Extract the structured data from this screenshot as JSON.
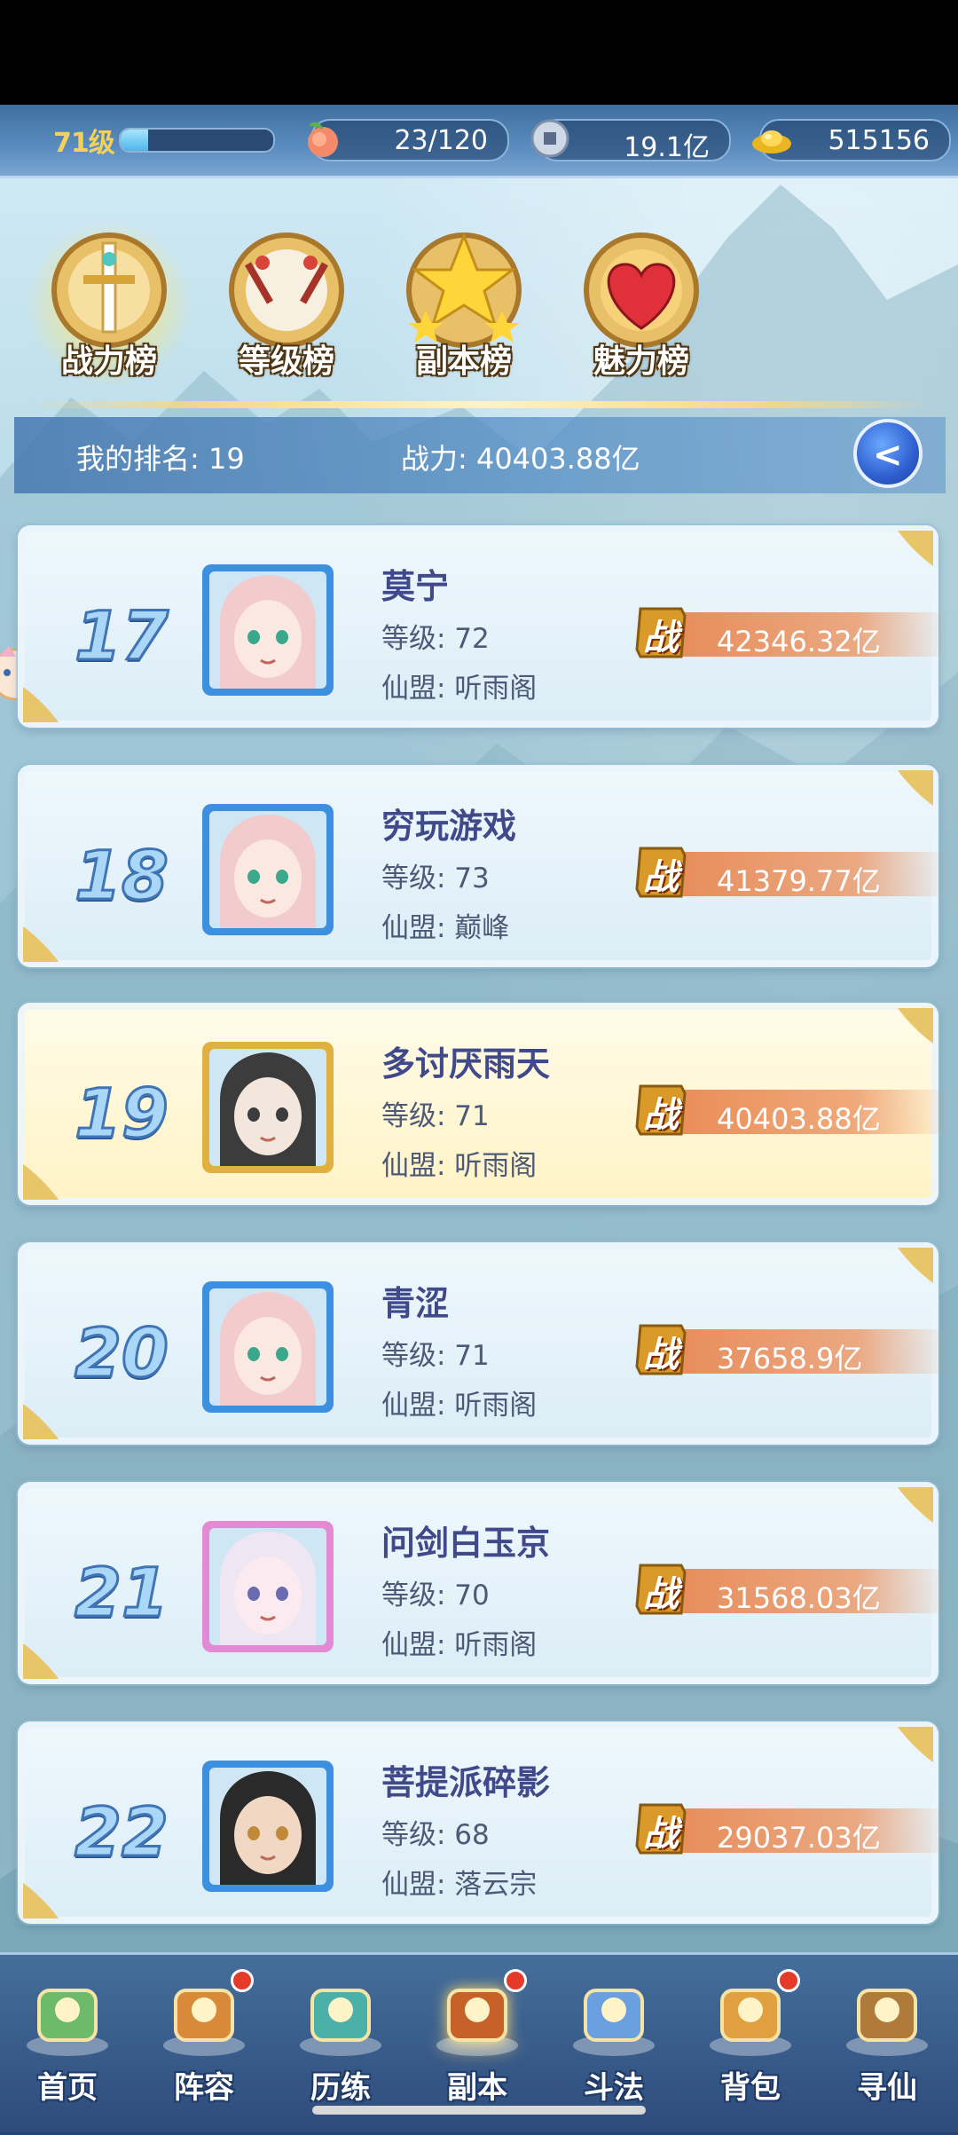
{
  "status": {
    "level": "71级",
    "level_progress": 0.18,
    "stamina": "23/120",
    "copper": "19.1亿",
    "gold": "515156"
  },
  "tabs": [
    {
      "label": "战力榜",
      "active": true
    },
    {
      "label": "等级榜",
      "active": false
    },
    {
      "label": "副本榜",
      "active": false
    },
    {
      "label": "魅力榜",
      "active": false
    }
  ],
  "my_rank": {
    "rank_text": "我的排名: 19",
    "power_text": "战力: 40403.88亿"
  },
  "power_badge": "战",
  "rankings": [
    {
      "rank": "17",
      "name": "莫宁",
      "level": "等级: 72",
      "guild": "仙盟: 听雨阁",
      "power": "42346.32亿",
      "avatar": "pink-hair-girl-avatar"
    },
    {
      "rank": "18",
      "name": "穷玩游戏",
      "level": "等级: 73",
      "guild": "仙盟: 巅峰",
      "power": "41379.77亿",
      "avatar": "pink-hair-girl-avatar"
    },
    {
      "rank": "19",
      "name": "多讨厌雨天",
      "level": "等级: 71",
      "guild": "仙盟: 听雨阁",
      "power": "40403.88亿",
      "avatar": "dark-hair-sleeping-avatar"
    },
    {
      "rank": "20",
      "name": "青涩",
      "level": "等级: 71",
      "guild": "仙盟: 听雨阁",
      "power": "37658.9亿",
      "avatar": "pink-hair-girl-avatar"
    },
    {
      "rank": "21",
      "name": "问剑白玉京",
      "level": "等级: 70",
      "guild": "仙盟: 听雨阁",
      "power": "31568.03亿",
      "avatar": "white-hair-girl-avatar"
    },
    {
      "rank": "22",
      "name": "菩提派碎影",
      "level": "等级: 68",
      "guild": "仙盟: 落云宗",
      "power": "29037.03亿",
      "avatar": "dark-hair-boy-avatar"
    }
  ],
  "nav": [
    {
      "label": "首页",
      "icon": "home-icon",
      "badge": false
    },
    {
      "label": "阵容",
      "icon": "lineup-icon",
      "badge": true
    },
    {
      "label": "历练",
      "icon": "training-icon",
      "badge": false
    },
    {
      "label": "副本",
      "icon": "dungeon-icon",
      "badge": true
    },
    {
      "label": "斗法",
      "icon": "battle-icon",
      "badge": false
    },
    {
      "label": "背包",
      "icon": "bag-icon",
      "badge": true
    },
    {
      "label": "寻仙",
      "icon": "scroll-icon",
      "badge": false
    }
  ],
  "colors": {
    "accent_gold": "#f3d25b",
    "power_orange": "#e8824b",
    "name_color": "#404a8a",
    "rank_blue": "#3f74b5"
  }
}
